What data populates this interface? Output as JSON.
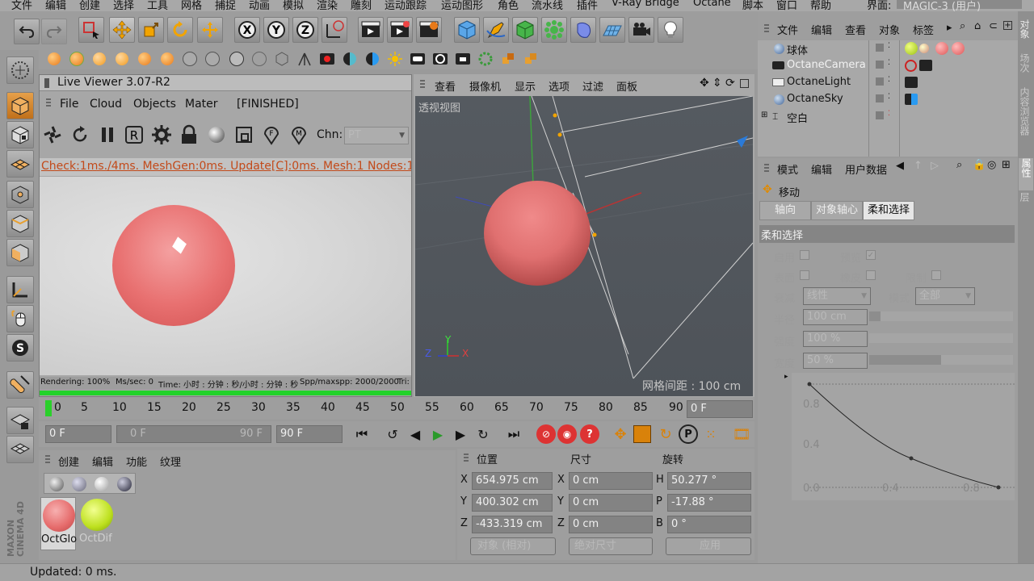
{
  "menubar": {
    "items": [
      "文件",
      "编辑",
      "创建",
      "选择",
      "工具",
      "网格",
      "捕捉",
      "动画",
      "模拟",
      "渲染",
      "雕刻",
      "运动跟踪",
      "运动图形",
      "角色",
      "流水线",
      "插件",
      "V-Ray Bridge",
      "Octane",
      "脚本",
      "窗口",
      "帮助"
    ],
    "layout_label": "界面:",
    "layout_value": "MAGIC-3 (用户)"
  },
  "live_viewer": {
    "title": "Live Viewer 3.07-R2",
    "menu": [
      "File",
      "Cloud",
      "Objects",
      "Mater",
      "[FINISHED]"
    ],
    "chn_label": "Chn:",
    "chn_value": "PT",
    "stats": "Check:1ms./4ms. MeshGen:0ms. Update[C]:0ms. Mesh:1 Nodes:17 Mo",
    "status": {
      "rendering": "Rendering: 100%",
      "ms_sec": "Ms/sec: 0",
      "time": "Time: 小时 : 分钟 : 秒/小时 : 分钟 : 秒",
      "spp": "Spp/maxspp: 2000/2000",
      "tri": "Tri:"
    },
    "progress": 1.0
  },
  "viewport": {
    "menu": [
      "查看",
      "摄像机",
      "显示",
      "选项",
      "过滤",
      "面板"
    ],
    "view_name": "透视视图",
    "grid_spacing": "网格间距 : 100 cm",
    "axes": {
      "x": "X",
      "y": "Y",
      "z": "Z"
    }
  },
  "timeline": {
    "ticks": [
      "0",
      "5",
      "10",
      "15",
      "20",
      "25",
      "30",
      "35",
      "40",
      "45",
      "50",
      "55",
      "60",
      "65",
      "70",
      "75",
      "80",
      "85",
      "90"
    ],
    "current_frame_field": "0 F",
    "start_field": "0 F",
    "range_min": "0 F",
    "range_max": "90 F",
    "end_field": "90 F"
  },
  "material_manager": {
    "menu": [
      "创建",
      "编辑",
      "功能",
      "纹理"
    ],
    "materials": [
      {
        "name": "OctGlo",
        "color": "#e56a6a"
      },
      {
        "name": "OctDif",
        "color": "#bde01e"
      }
    ]
  },
  "coordinates": {
    "headers": {
      "position": "位置",
      "size": "尺寸",
      "rotation": "旋转"
    },
    "rows": [
      {
        "pos_label": "X",
        "pos": "654.975 cm",
        "size_label": "X",
        "size": "0 cm",
        "rot_label": "H",
        "rot": "50.277 °"
      },
      {
        "pos_label": "Y",
        "pos": "400.302 cm",
        "size_label": "Y",
        "size": "0 cm",
        "rot_label": "P",
        "rot": "-17.88 °"
      },
      {
        "pos_label": "Z",
        "pos": "-433.319 cm",
        "size_label": "Z",
        "size": "0 cm",
        "rot_label": "B",
        "rot": "0 °"
      }
    ],
    "mode_dropdown": "对象 (相对)",
    "size_dropdown": "绝对尺寸",
    "apply_button": "应用"
  },
  "object_manager": {
    "menu": [
      "文件",
      "编辑",
      "查看",
      "对象",
      "标签"
    ],
    "objects": [
      {
        "name": "球体"
      },
      {
        "name": "OctaneCamera"
      },
      {
        "name": "OctaneLight"
      },
      {
        "name": "OctaneSky"
      },
      {
        "name": "空白"
      }
    ]
  },
  "attributes": {
    "menu": [
      "模式",
      "编辑",
      "用户数据"
    ],
    "tool_name": "移动",
    "tabs": [
      "轴向",
      "对象轴心",
      "柔和选择"
    ],
    "active_tab": "柔和选择",
    "section": "柔和选择",
    "fields": {
      "enable_label": "启用",
      "preview_label": "预览",
      "surface_label": "表面",
      "rubber_label": "橡皮",
      "limit_label": "限制",
      "falloff_label": "衰减",
      "falloff_value": "线性",
      "mode_label": "模式",
      "mode_value": "全部",
      "radius_label": "半径",
      "radius_value": "100 cm",
      "strength_label": "强度",
      "strength_value": "100 %",
      "width_label": "宽度",
      "width_value": "50 %"
    },
    "curve": {
      "y_ticks": [
        "0.8",
        "0.4",
        "0.0"
      ],
      "x_ticks": [
        "0.4",
        "0.8"
      ]
    }
  },
  "right_tabs": [
    "对象",
    "场次",
    "内容浏览器",
    "属性",
    "层"
  ],
  "status_bar": "Updated: 0 ms.",
  "logo_text": "MAXON CINEMA 4D",
  "colors": {
    "sphere": "#e86f6f",
    "viewport_bg": "#4f545a",
    "green_material": "#bde01e",
    "active_tab": "#e6e6e6"
  }
}
